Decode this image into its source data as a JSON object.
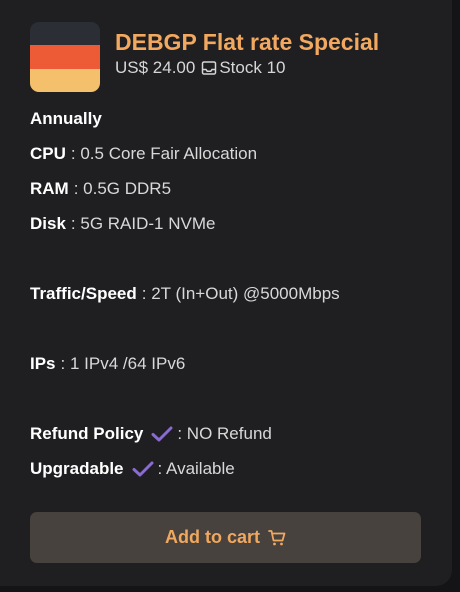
{
  "product": {
    "title": "DEBGP Flat rate Special",
    "price": "US$ 24.00",
    "stock": "Stock 10",
    "flag_colors": [
      "#2b2f35",
      "#ec5b35",
      "#f4c06c"
    ],
    "accent_color": "#f2a85f"
  },
  "specs": {
    "billing_cycle": "Annually",
    "cpu_label": "CPU",
    "cpu_value": ": 0.5 Core Fair Allocation",
    "ram_label": "RAM",
    "ram_value": ": 0.5G DDR5",
    "disk_label": "Disk",
    "disk_value": ": 5G RAID-1 NVMe",
    "traffic_label": "Traffic/Speed",
    "traffic_value": ": 2T (In+Out) @5000Mbps",
    "ips_label": "IPs",
    "ips_value": ": 1 IPv4 /64 IPv6",
    "refund_label": "Refund Policy",
    "refund_value": ": NO Refund",
    "upgradable_label": "Upgradable",
    "upgradable_value": ": Available",
    "check_color": "#8a6bd1"
  },
  "actions": {
    "add_to_cart_label": "Add to cart",
    "button_color": "#48423f"
  },
  "icons": {
    "stock": "inbox-icon",
    "check": "check-icon",
    "cart": "cart-icon"
  }
}
